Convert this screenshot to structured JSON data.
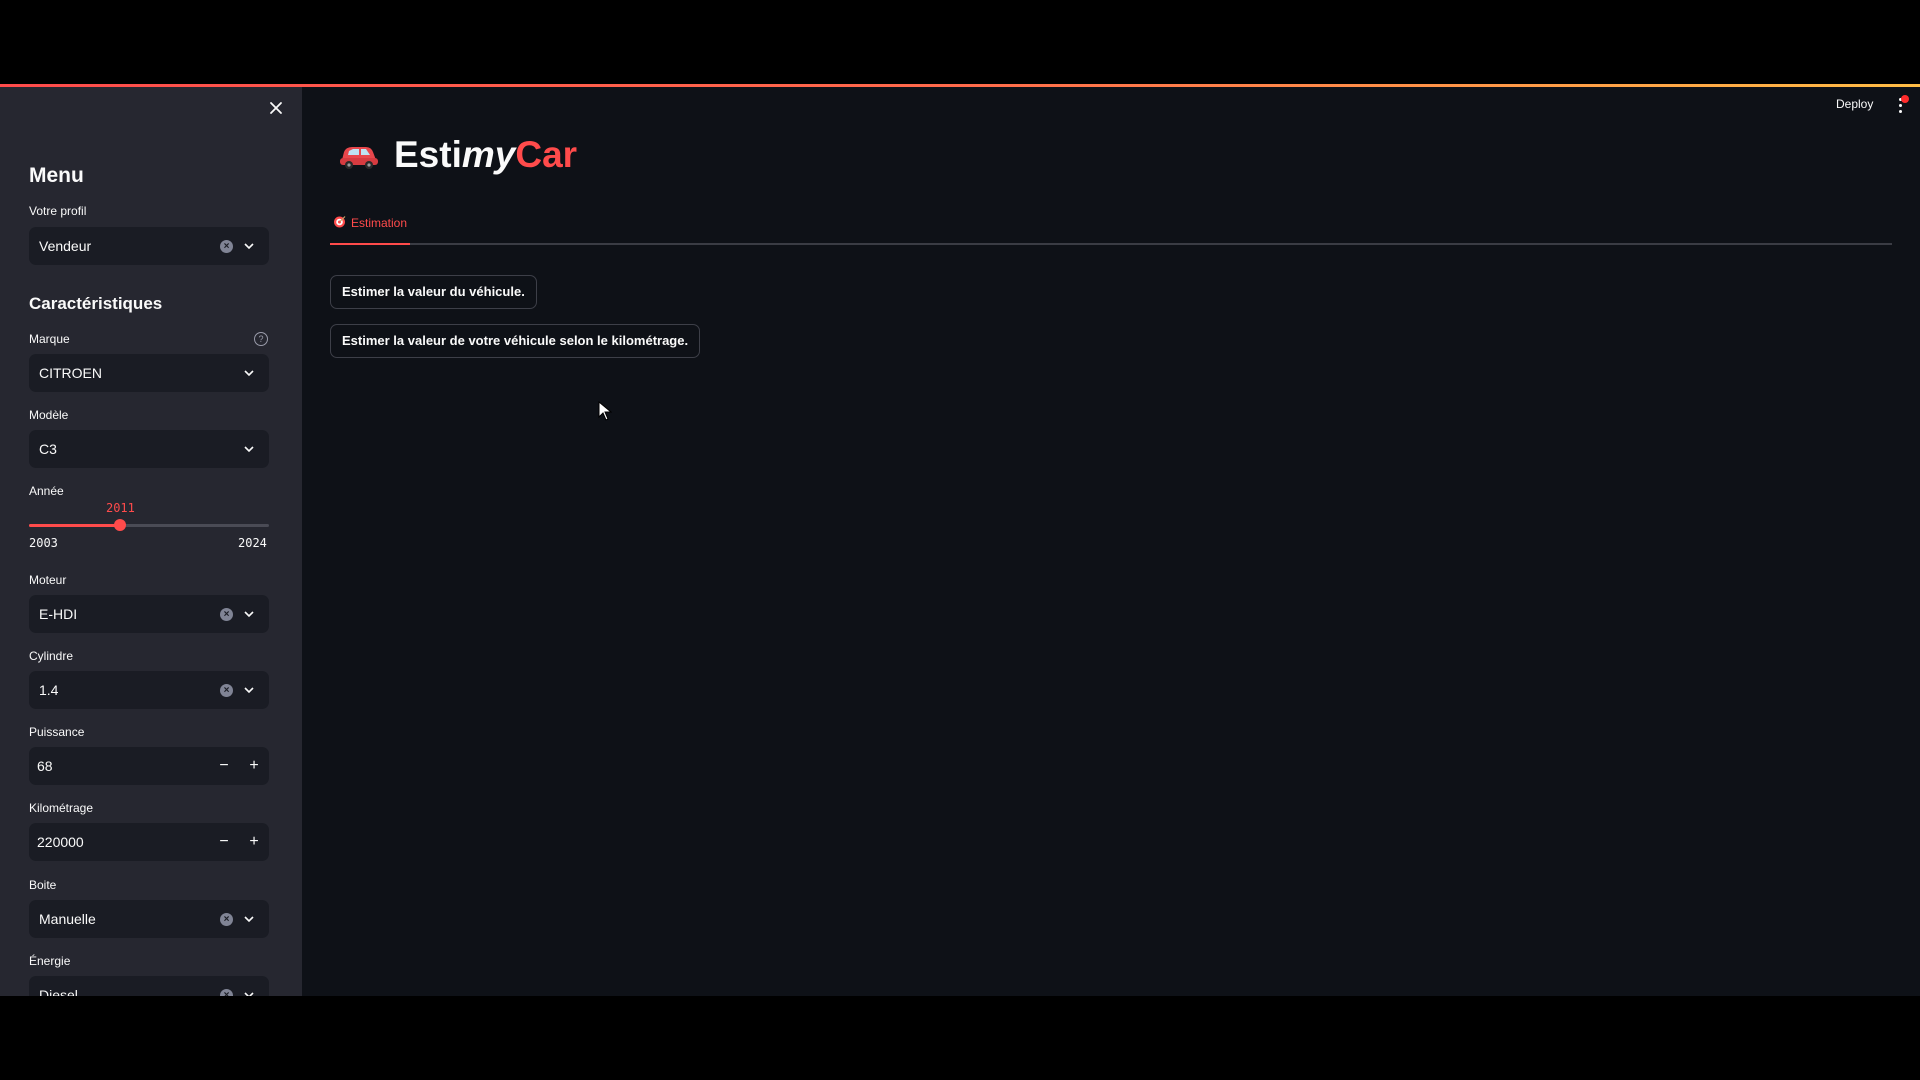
{
  "app": {
    "deploy_label": "Deploy"
  },
  "sidebar": {
    "menu_heading": "Menu",
    "profile": {
      "label": "Votre profil",
      "value": "Vendeur"
    },
    "characteristics_heading": "Caractéristiques",
    "marque": {
      "label": "Marque",
      "value": "CITROEN"
    },
    "modele": {
      "label": "Modèle",
      "value": "C3"
    },
    "annee": {
      "label": "Année",
      "min": "2003",
      "max": "2024",
      "value": "2011"
    },
    "moteur": {
      "label": "Moteur",
      "value": "E-HDI"
    },
    "cylindre": {
      "label": "Cylindre",
      "value": "1.4"
    },
    "puissance": {
      "label": "Puissance",
      "value": "68"
    },
    "kilometrage": {
      "label": "Kilométrage",
      "value": "220000"
    },
    "boite": {
      "label": "Boite",
      "value": "Manuelle"
    },
    "energie": {
      "label": "Énergie",
      "value": "Diesel"
    }
  },
  "main": {
    "title": {
      "part1": "Esti",
      "part2": "my",
      "part3": "Car"
    },
    "tabs": [
      {
        "label": "Estimation"
      }
    ],
    "buttons": {
      "estimate_value": "Estimer la valeur du véhicule.",
      "estimate_by_km": "Estimer la valeur de votre véhicule selon le kilométrage."
    }
  },
  "colors": {
    "accent": "#ff4b4b",
    "background": "#0e1117",
    "sidebar": "#262730"
  },
  "icons": [
    "close-icon",
    "help-icon",
    "chevron-down-icon",
    "clear-icon",
    "car-icon",
    "target-icon",
    "menu-icon"
  ]
}
